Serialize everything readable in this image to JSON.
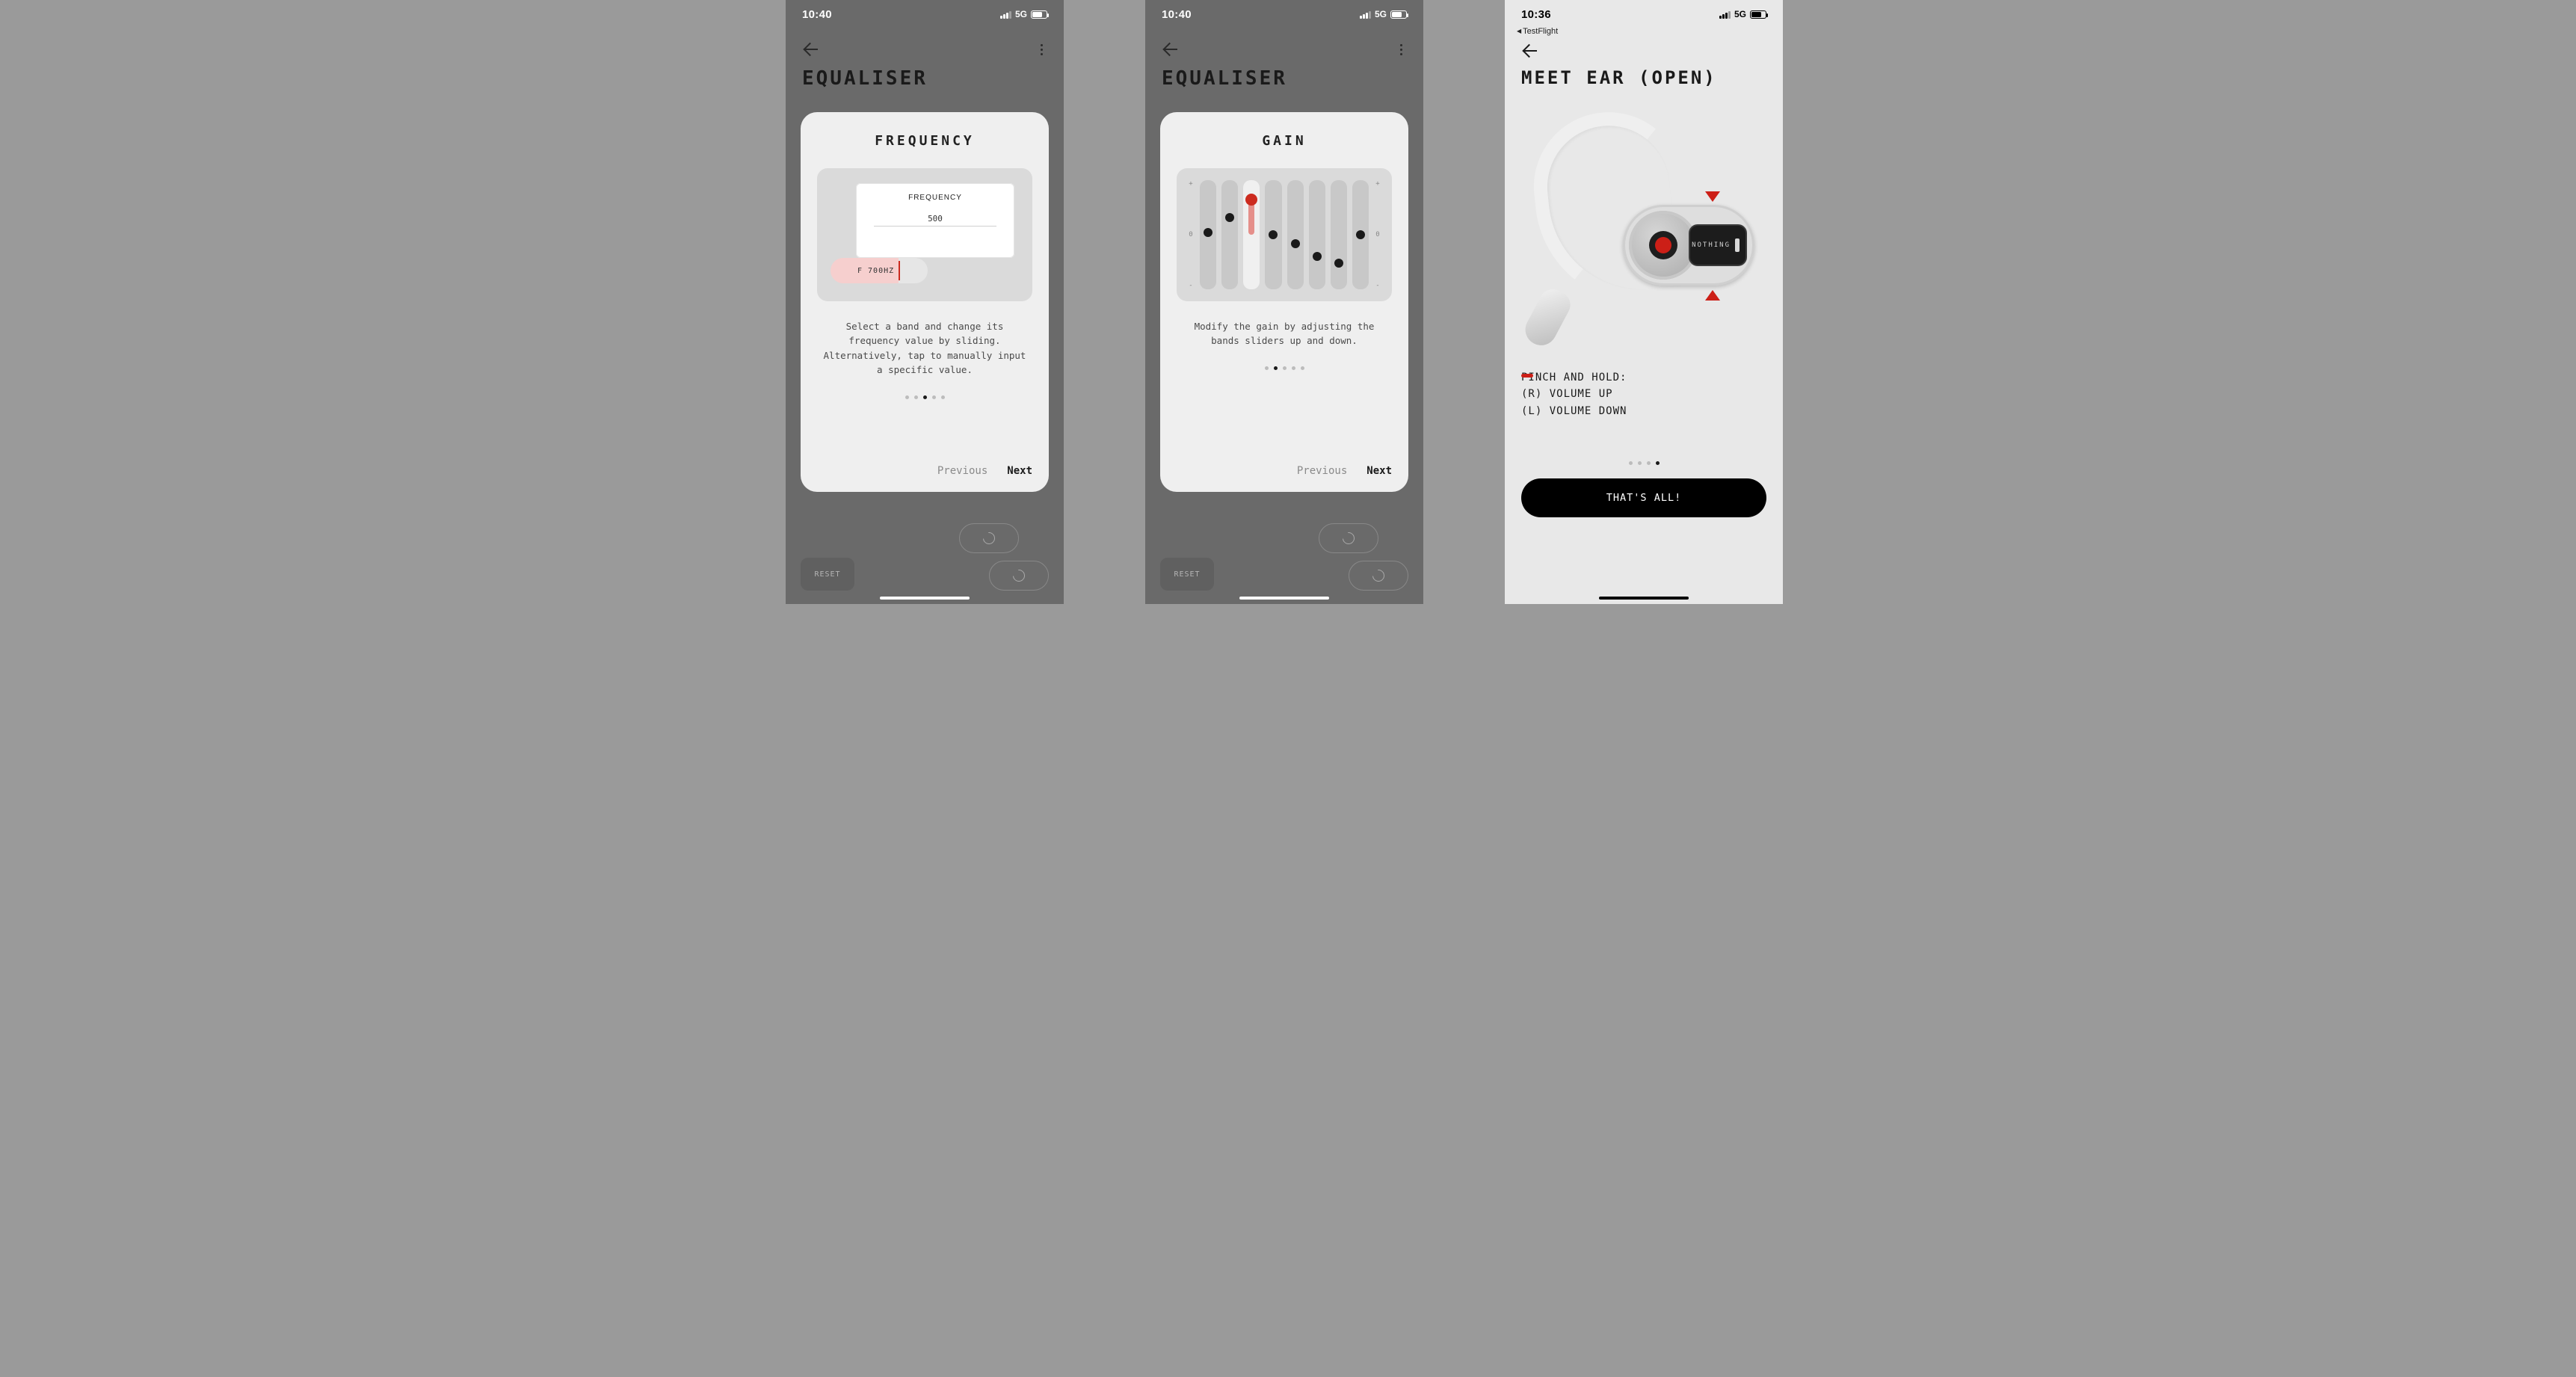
{
  "screens": {
    "s1": {
      "status": {
        "time": "10:40",
        "net": "5G"
      },
      "page_title": "EQUALISER",
      "card": {
        "title": "FREQUENCY",
        "freq_label": "FREQUENCY",
        "freq_input_value": "500",
        "freq_pill_text": "F 700HZ",
        "desc": "Select a band and change its frequency value by sliding. Alternatively, tap to manually input a specific value.",
        "page_index": 2,
        "page_count": 5,
        "prev": "Previous",
        "next": "Next"
      },
      "bg": {
        "reset": "RESET"
      }
    },
    "s2": {
      "status": {
        "time": "10:40",
        "net": "5G"
      },
      "page_title": "EQUALISER",
      "card": {
        "title": "GAIN",
        "gain_axis": {
          "top": "+",
          "mid": "0",
          "bot": "-"
        },
        "bands": [
          {
            "value": 0.52,
            "active": false
          },
          {
            "value": 0.66,
            "active": false
          },
          {
            "value": 0.82,
            "active": true
          },
          {
            "value": 0.5,
            "active": false
          },
          {
            "value": 0.42,
            "active": false
          },
          {
            "value": 0.3,
            "active": false
          },
          {
            "value": 0.24,
            "active": false
          },
          {
            "value": 0.5,
            "active": false
          }
        ],
        "desc": "Modify the gain by adjusting the bands sliders up and down.",
        "page_index": 1,
        "page_count": 5,
        "prev": "Previous",
        "next": "Next"
      },
      "bg": {
        "reset": "RESET"
      }
    },
    "s3": {
      "status": {
        "time": "10:36",
        "net": "5G"
      },
      "breadcrumb": "TestFlight",
      "page_title": "MEET EAR (OPEN)",
      "earbud_brand": "NOTHING",
      "gesture": {
        "heading": "PINCH AND HOLD:",
        "right": "(R) VOLUME UP",
        "left": "(L) VOLUME DOWN"
      },
      "page_index": 3,
      "page_count": 4,
      "cta": "THAT'S ALL!"
    }
  },
  "colors": {
    "accent": "#cc1f17"
  }
}
